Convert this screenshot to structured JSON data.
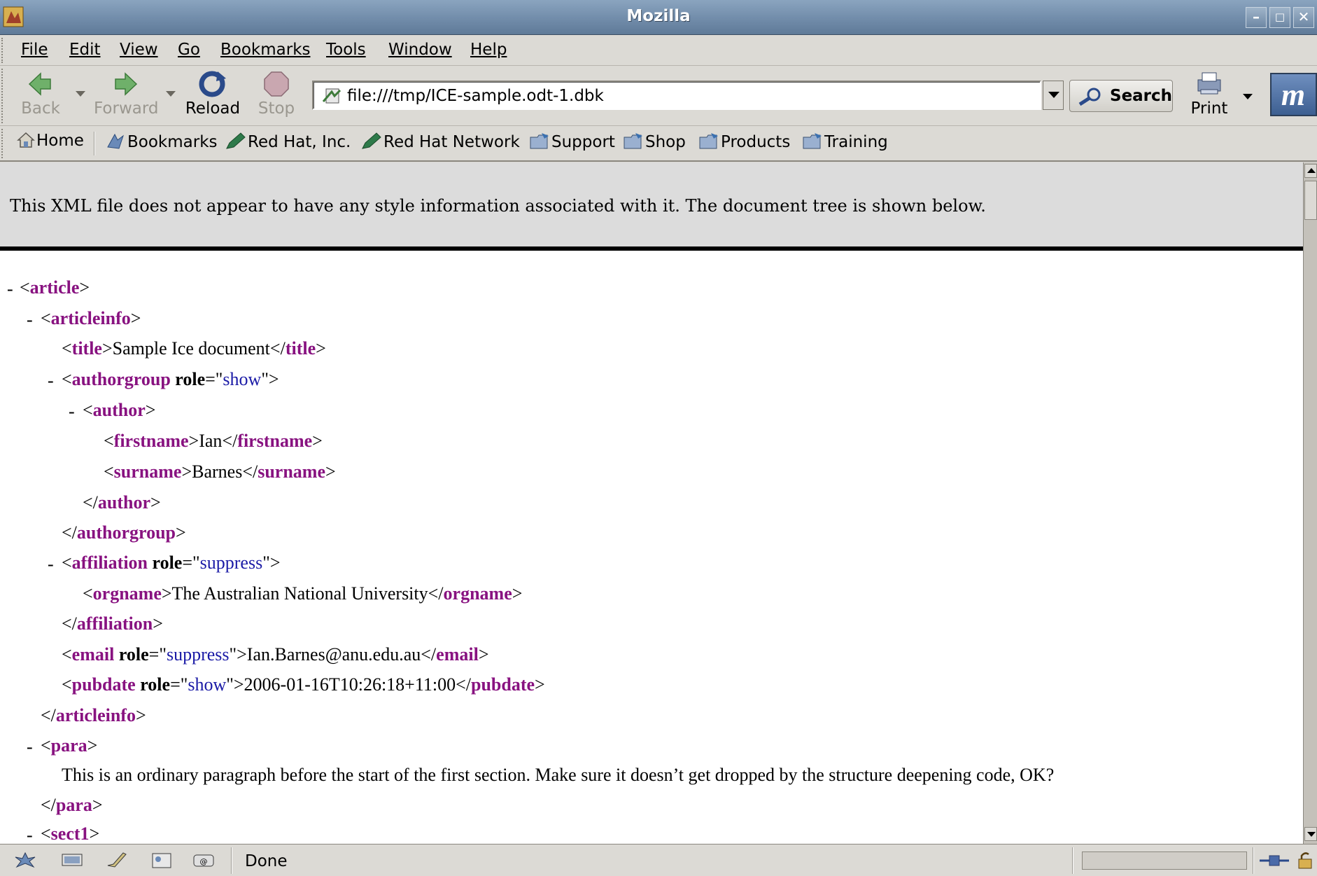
{
  "window": {
    "title": "Mozilla"
  },
  "menu": [
    "File",
    "Edit",
    "View",
    "Go",
    "Bookmarks",
    "Tools",
    "Window",
    "Help"
  ],
  "nav": {
    "back": "Back",
    "forward": "Forward",
    "reload": "Reload",
    "stop": "Stop",
    "url": "file:///tmp/ICE-sample.odt-1.dbk",
    "search": "Search",
    "print": "Print"
  },
  "bookmarks": [
    "Home",
    "Bookmarks",
    "Red Hat, Inc.",
    "Red Hat Network",
    "Support",
    "Shop",
    "Products",
    "Training"
  ],
  "content": {
    "style_note": "This XML file does not appear to have any style information associated with it. The document tree is shown below.",
    "tree": {
      "article": "article",
      "articleinfo": "articleinfo",
      "title_tag": "title",
      "title_text": "Sample Ice document",
      "authorgroup": "authorgroup",
      "role_attr": "role",
      "show": "show",
      "suppress": "suppress",
      "author": "author",
      "firstname": "firstname",
      "firstname_text": "Ian",
      "surname": "surname",
      "surname_text": "Barnes",
      "affiliation": "affiliation",
      "orgname": "orgname",
      "orgname_text": "The Australian National University",
      "email": "email",
      "email_text": "Ian.Barnes@anu.edu.au",
      "pubdate": "pubdate",
      "pubdate_text": "2006-01-16T10:26:18+11:00",
      "para": "para",
      "para_text": "This is an ordinary paragraph before the start of the first section. Make sure it doesn’t get dropped by the structure deepening code, OK?",
      "sect1": "sect1"
    }
  },
  "status": {
    "text": "Done"
  },
  "colors": {
    "tag": "#881280",
    "attr_value": "#1a1aa6",
    "titlebar": "#6f8aa8"
  }
}
